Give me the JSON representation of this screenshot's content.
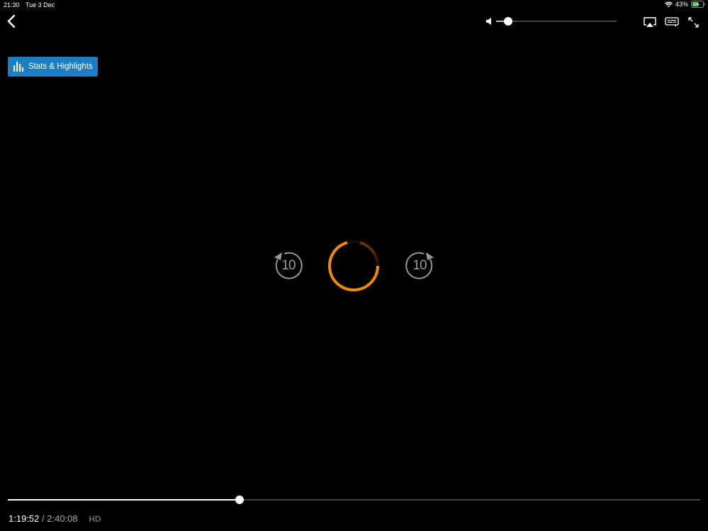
{
  "status_bar": {
    "time": "21:30",
    "date": "Tue 3 Dec",
    "battery": "43%",
    "wifi_icon": "wifi-icon",
    "battery_icon": "battery-charging-icon"
  },
  "top_bar": {
    "back_icon": "chevron-left-icon",
    "volume_level": 0.1,
    "airplay_icon": "airplay-icon",
    "subtitles_icon": "subtitles-icon",
    "expand_icon": "expand-icon"
  },
  "stats_button": {
    "label": "Stats & Highlights",
    "icon": "bar-chart-icon",
    "color": "#1a7fc4"
  },
  "center_controls": {
    "rewind_label": "10",
    "forward_label": "10",
    "spinner_color": "#f08a00"
  },
  "playback": {
    "current_time": "1:19:52",
    "separator": "/",
    "total_time": "2:40:08",
    "quality": "HD",
    "progress": 0.335
  }
}
